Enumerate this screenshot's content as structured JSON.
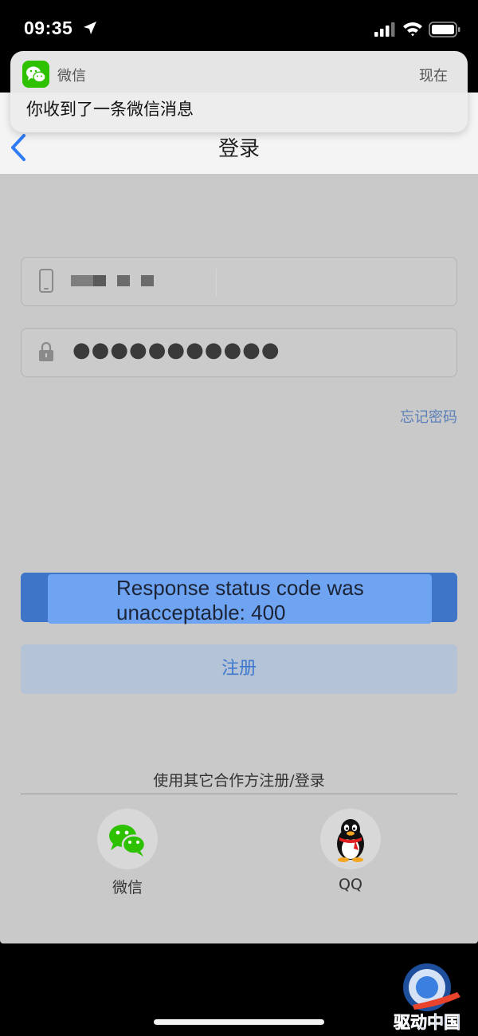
{
  "status_bar": {
    "time": "09:35",
    "icons": [
      "location-arrow-icon",
      "cellular-signal-icon",
      "wifi-icon",
      "battery-icon"
    ]
  },
  "notification": {
    "app_name": "微信",
    "time": "现在",
    "message": "你收到了一条微信消息",
    "app_icon": "wechat-icon"
  },
  "navbar": {
    "title": "登录",
    "back_icon": "chevron-left-icon"
  },
  "form": {
    "phone": {
      "icon": "phone-icon",
      "value_masked": true
    },
    "password": {
      "icon": "lock-icon",
      "value": "●●●●●●●●●●●"
    },
    "forgot_password": "忘记密码"
  },
  "toast": {
    "line1": "Response status code was",
    "line2": "unacceptable: 400"
  },
  "register_button": "注册",
  "other_login": {
    "label": "使用其它合作方注册/登录",
    "partners": [
      {
        "label": "微信",
        "icon": "wechat-icon"
      },
      {
        "label": "QQ",
        "icon": "qq-penguin-icon"
      }
    ]
  },
  "watermark": {
    "text": "驱动中国",
    "icon": "q-logo-icon"
  },
  "colors": {
    "accent_blue": "#3f75c9",
    "toast_blue": "#6ea4f2",
    "link_blue": "#5b7fb8",
    "wechat_green": "#2dc100"
  }
}
